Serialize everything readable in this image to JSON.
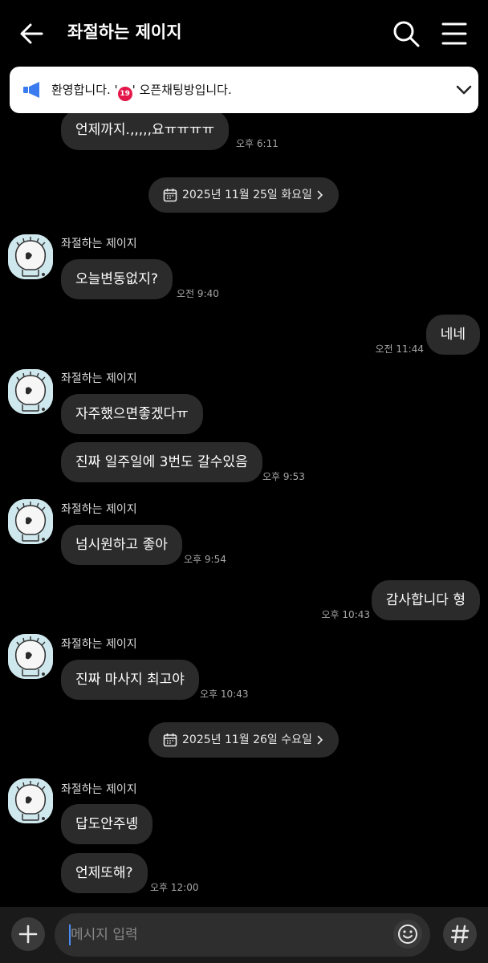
{
  "header": {
    "title": "좌절하는 제이지",
    "back_icon": "arrow-left-icon",
    "search_icon": "search-icon",
    "menu_icon": "hamburger-menu-icon"
  },
  "notice": {
    "icon": "megaphone-icon",
    "text_before": "환영합니다. '",
    "badge": "19",
    "text_after": "' 오픈채팅방입니다.",
    "chevron_icon": "chevron-down-icon"
  },
  "messages": {
    "m0": {
      "text": "언제까지.,,,,,요ㅠㅠㅠㅠ",
      "time": "오후 6:11"
    },
    "date1": "2025년 11월 25일 화요일",
    "g1": {
      "sender": "좌절하는 제이지",
      "text": "오늘변동없지?",
      "time": "오전 9:40"
    },
    "mine1": {
      "text": "네네",
      "time": "오전 11:44"
    },
    "g2": {
      "sender": "좌절하는 제이지",
      "text1": "자주했으면좋겠다ㅠ",
      "text2": "진짜 일주일에 3번도 갈수있음",
      "time": "오후 9:53"
    },
    "g3": {
      "sender": "좌절하는 제이지",
      "text": "넘시원하고 좋아",
      "time": "오후 9:54"
    },
    "mine2": {
      "text": "감사합니다 형",
      "time": "오후 10:43"
    },
    "g4": {
      "sender": "좌절하는 제이지",
      "text": "진짜 마사지 최고야",
      "time": "오후 10:43"
    },
    "date2": "2025년 11월 26일 수요일",
    "g5": {
      "sender": "좌절하는 제이지",
      "text1": "답도안주녱",
      "text2": "언제또해?",
      "time": "오후 12:00"
    }
  },
  "input": {
    "placeholder": "메시지 입력",
    "plus_icon": "plus-icon",
    "emoji_icon": "emoji-icon",
    "hash_icon": "hashtag-icon"
  },
  "colors": {
    "background": "#000000",
    "bubble": "#2b2b2b",
    "notice_bg": "#ffffff",
    "accent_blue": "#3a7cf0"
  }
}
